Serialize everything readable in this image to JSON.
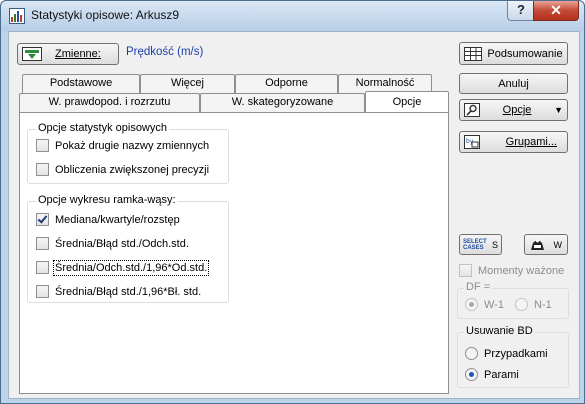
{
  "window": {
    "title": "Statystyki opisowe: Arkusz9",
    "help_label": "?",
    "close_label": "✕"
  },
  "variables": {
    "button_label": "Zmienne:",
    "value": "Prędkość (m/s)"
  },
  "tabs": {
    "row1": [
      "Podstawowe",
      "Więcej",
      "Odporne",
      "Normalność"
    ],
    "row2": [
      "W. prawdopod. i rozrzutu",
      "W. skategoryzowane",
      "Opcje"
    ],
    "active": "Opcje"
  },
  "group_stats": {
    "title": "Opcje statystyk opisowych",
    "options": [
      {
        "label": "Pokaż drugie nazwy zmiennych",
        "checked": false
      },
      {
        "label": "Obliczenia zwiększonej precyzji",
        "checked": false
      }
    ]
  },
  "group_box": {
    "title": "Opcje wykresu ramka-wąsy:",
    "options": [
      {
        "label": "Mediana/kwartyle/rozstęp",
        "checked": true
      },
      {
        "label": "Średnia/Błąd std./Odch.std.",
        "checked": false
      },
      {
        "label": "Średnia/Odch.std./1,96*Od.std.",
        "checked": false
      },
      {
        "label": "Średnia/Błąd std./1,96*Bł. std.",
        "checked": false
      }
    ]
  },
  "right": {
    "summary_label": "Podsumowanie",
    "cancel_label": "Anuluj",
    "options_label": "Opcje",
    "groups_label": "Grupami...",
    "select_cases_label": "SELECT\nCASES",
    "select_cases_suffix": "S",
    "weight_suffix": "W",
    "weighted_moments_label": "Momenty ważone",
    "df_title": "DF =",
    "df_options": [
      "W-1",
      "N-1"
    ],
    "missing_title": "Usuwanie BD",
    "missing_options": [
      "Przypadkami",
      "Parami"
    ]
  }
}
